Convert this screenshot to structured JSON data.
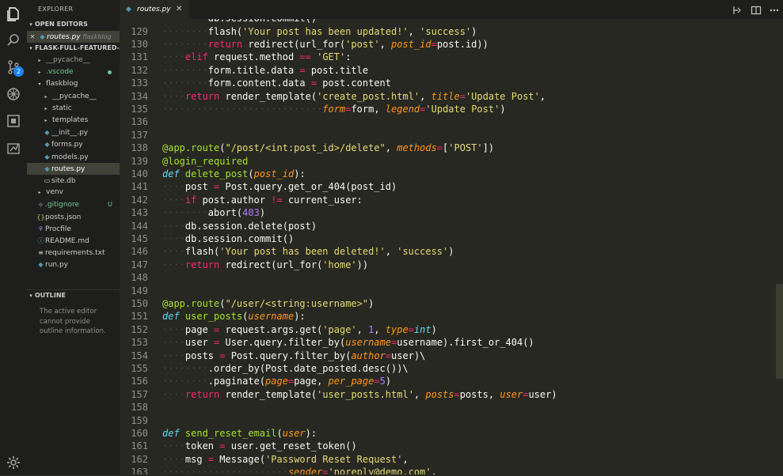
{
  "sidebar": {
    "title": "EXPLORER",
    "open_editors_header": "OPEN EDITORS",
    "open_editor": {
      "close": "✕",
      "name": "routes.py",
      "folder": "flaskblog"
    },
    "project_header": "FLASK-FULL-FEATURED-...",
    "tree": [
      {
        "name": "__pycache__",
        "depth": 0,
        "type": "folder",
        "state": "collapsed",
        "color": "#9d9d9d"
      },
      {
        "name": ".vscode",
        "depth": 0,
        "type": "folder",
        "state": "collapsed",
        "color": "#73c991",
        "dot": true
      },
      {
        "name": "flaskblog",
        "depth": 0,
        "type": "folder",
        "state": "expanded",
        "color": "#cccccc"
      },
      {
        "name": "__pycache__",
        "depth": 1,
        "type": "folder",
        "state": "collapsed",
        "color": "#cccccc"
      },
      {
        "name": "static",
        "depth": 1,
        "type": "folder",
        "state": "collapsed",
        "color": "#cccccc"
      },
      {
        "name": "templates",
        "depth": 1,
        "type": "folder",
        "state": "collapsed",
        "color": "#cccccc"
      },
      {
        "name": "__init__.py",
        "depth": 1,
        "type": "py",
        "color": "#cccccc"
      },
      {
        "name": "forms.py",
        "depth": 1,
        "type": "py",
        "color": "#cccccc"
      },
      {
        "name": "models.py",
        "depth": 1,
        "type": "py",
        "color": "#cccccc"
      },
      {
        "name": "routes.py",
        "depth": 1,
        "type": "py",
        "color": "#ffffff",
        "selected": true
      },
      {
        "name": "site.db",
        "depth": 1,
        "type": "db",
        "color": "#cccccc"
      },
      {
        "name": "venv",
        "depth": 0,
        "type": "folder",
        "state": "collapsed",
        "color": "#cccccc"
      },
      {
        "name": ".gitignore",
        "depth": 0,
        "type": "git",
        "color": "#73c991",
        "status": "U"
      },
      {
        "name": "posts.json",
        "depth": 0,
        "type": "json",
        "color": "#cccccc"
      },
      {
        "name": "Procfile",
        "depth": 0,
        "type": "procfile",
        "color": "#cccccc"
      },
      {
        "name": "README.md",
        "depth": 0,
        "type": "md",
        "color": "#cccccc"
      },
      {
        "name": "requirements.txt",
        "depth": 0,
        "type": "txt",
        "color": "#cccccc"
      },
      {
        "name": "run.py",
        "depth": 0,
        "type": "py",
        "color": "#cccccc"
      }
    ],
    "outline_header": "OUTLINE",
    "outline_message": "The active editor cannot provide outline information."
  },
  "activity_bar": {
    "items": [
      "explorer-icon",
      "search-icon",
      "source-control-icon",
      "debug-icon",
      "extensions-icon",
      "remote-explorer-icon"
    ],
    "source_control_badge": "2",
    "bottom": "gear-icon"
  },
  "tabs": [
    {
      "label": "routes.py",
      "close": "✕"
    }
  ],
  "tab_actions": [
    "open-changes-icon",
    "split-editor-icon",
    "more-actions-icon"
  ],
  "editor": {
    "lines": [
      {
        "n": "129",
        "ws": "········",
        "tokens": [
          [
            "n",
            "flash("
          ],
          [
            "s",
            "'Your post has been updated!'"
          ],
          [
            "n",
            ", "
          ],
          [
            "s",
            "'success'"
          ],
          [
            "n",
            ")"
          ]
        ]
      },
      {
        "n": "130",
        "ws": "········",
        "tokens": [
          [
            "k",
            "return"
          ],
          [
            "n",
            " redirect(url_for("
          ],
          [
            "s",
            "'post'"
          ],
          [
            "n",
            ", "
          ],
          [
            "p",
            "post_id"
          ],
          [
            "k",
            "="
          ],
          [
            "n",
            "post.id))"
          ]
        ]
      },
      {
        "n": "131",
        "ws": "····",
        "tokens": [
          [
            "k",
            "elif"
          ],
          [
            "n",
            " request.method "
          ],
          [
            "k",
            "=="
          ],
          [
            "n",
            " "
          ],
          [
            "s",
            "'GET'"
          ],
          [
            "n",
            ":"
          ]
        ]
      },
      {
        "n": "132",
        "ws": "········",
        "tokens": [
          [
            "n",
            "form.title.data "
          ],
          [
            "k",
            "="
          ],
          [
            "n",
            " post.title"
          ]
        ]
      },
      {
        "n": "133",
        "ws": "········",
        "tokens": [
          [
            "n",
            "form.content.data "
          ],
          [
            "k",
            "="
          ],
          [
            "n",
            " post.content"
          ]
        ]
      },
      {
        "n": "134",
        "ws": "····",
        "tokens": [
          [
            "k",
            "return"
          ],
          [
            "n",
            " render_template("
          ],
          [
            "s",
            "'create_post.html'"
          ],
          [
            "n",
            ", "
          ],
          [
            "p",
            "title"
          ],
          [
            "k",
            "="
          ],
          [
            "s",
            "'Update Post'"
          ],
          [
            "n",
            ","
          ]
        ]
      },
      {
        "n": "135",
        "ws": "····························",
        "tokens": [
          [
            "p",
            "form"
          ],
          [
            "k",
            "="
          ],
          [
            "n",
            "form, "
          ],
          [
            "p",
            "legend"
          ],
          [
            "k",
            "="
          ],
          [
            "s",
            "'Update Post'"
          ],
          [
            "n",
            ")"
          ]
        ]
      },
      {
        "n": "136",
        "ws": "",
        "tokens": []
      },
      {
        "n": "137",
        "ws": "",
        "tokens": []
      },
      {
        "n": "138",
        "ws": "",
        "tokens": [
          [
            "d",
            "@app.route"
          ],
          [
            "n",
            "("
          ],
          [
            "s",
            "\"/post/<int:post_id>/delete\""
          ],
          [
            "n",
            ", "
          ],
          [
            "p",
            "methods"
          ],
          [
            "k",
            "="
          ],
          [
            "n",
            "["
          ],
          [
            "s",
            "'POST'"
          ],
          [
            "n",
            "])"
          ]
        ]
      },
      {
        "n": "139",
        "ws": "",
        "tokens": [
          [
            "d",
            "@login_required"
          ]
        ]
      },
      {
        "n": "140",
        "ws": "",
        "tokens": [
          [
            "t",
            "def"
          ],
          [
            "n",
            " "
          ],
          [
            "f",
            "delete_post"
          ],
          [
            "n",
            "("
          ],
          [
            "p",
            "post_id"
          ],
          [
            "n",
            "):"
          ]
        ]
      },
      {
        "n": "141",
        "ws": "····",
        "tokens": [
          [
            "n",
            "post "
          ],
          [
            "k",
            "="
          ],
          [
            "n",
            " Post.query.get_or_404(post_id)"
          ]
        ]
      },
      {
        "n": "142",
        "ws": "····",
        "tokens": [
          [
            "k",
            "if"
          ],
          [
            "n",
            " post.author "
          ],
          [
            "k",
            "!="
          ],
          [
            "n",
            " current_user:"
          ]
        ]
      },
      {
        "n": "143",
        "ws": "········",
        "tokens": [
          [
            "n",
            "abort("
          ],
          [
            "c",
            "403"
          ],
          [
            "n",
            ")"
          ]
        ]
      },
      {
        "n": "144",
        "ws": "····",
        "tokens": [
          [
            "n",
            "db.session.delete(post)"
          ]
        ]
      },
      {
        "n": "145",
        "ws": "····",
        "tokens": [
          [
            "n",
            "db.session.commit()"
          ]
        ]
      },
      {
        "n": "146",
        "ws": "····",
        "tokens": [
          [
            "n",
            "flash("
          ],
          [
            "s",
            "'Your post has been deleted!'"
          ],
          [
            "n",
            ", "
          ],
          [
            "s",
            "'success'"
          ],
          [
            "n",
            ")"
          ]
        ]
      },
      {
        "n": "147",
        "ws": "····",
        "tokens": [
          [
            "k",
            "return"
          ],
          [
            "n",
            " redirect(url_for("
          ],
          [
            "s",
            "'home'"
          ],
          [
            "n",
            "))"
          ]
        ]
      },
      {
        "n": "148",
        "ws": "",
        "tokens": []
      },
      {
        "n": "149",
        "ws": "",
        "tokens": []
      },
      {
        "n": "150",
        "ws": "",
        "tokens": [
          [
            "d",
            "@app.route"
          ],
          [
            "n",
            "("
          ],
          [
            "s",
            "\"/user/<string:username>\""
          ],
          [
            "n",
            ")"
          ]
        ]
      },
      {
        "n": "151",
        "ws": "",
        "tokens": [
          [
            "t",
            "def"
          ],
          [
            "n",
            " "
          ],
          [
            "f",
            "user_posts"
          ],
          [
            "n",
            "("
          ],
          [
            "p",
            "username"
          ],
          [
            "n",
            "):"
          ]
        ]
      },
      {
        "n": "152",
        "ws": "····",
        "tokens": [
          [
            "n",
            "page "
          ],
          [
            "k",
            "="
          ],
          [
            "n",
            " request.args.get("
          ],
          [
            "s",
            "'page'"
          ],
          [
            "n",
            ", "
          ],
          [
            "c",
            "1"
          ],
          [
            "n",
            ", "
          ],
          [
            "p",
            "type"
          ],
          [
            "k",
            "="
          ],
          [
            "t",
            "int"
          ],
          [
            "n",
            ")"
          ]
        ]
      },
      {
        "n": "153",
        "ws": "····",
        "tokens": [
          [
            "n",
            "user "
          ],
          [
            "k",
            "="
          ],
          [
            "n",
            " User.query.filter_by("
          ],
          [
            "p",
            "username"
          ],
          [
            "k",
            "="
          ],
          [
            "n",
            "username).first_or_404()"
          ]
        ]
      },
      {
        "n": "154",
        "ws": "····",
        "tokens": [
          [
            "n",
            "posts "
          ],
          [
            "k",
            "="
          ],
          [
            "n",
            " Post.query.filter_by("
          ],
          [
            "p",
            "author"
          ],
          [
            "k",
            "="
          ],
          [
            "n",
            "user)\\"
          ]
        ]
      },
      {
        "n": "155",
        "ws": "········",
        "tokens": [
          [
            "n",
            ".order_by(Post.date_posted.desc())\\"
          ]
        ]
      },
      {
        "n": "156",
        "ws": "········",
        "tokens": [
          [
            "n",
            ".paginate("
          ],
          [
            "p",
            "page"
          ],
          [
            "k",
            "="
          ],
          [
            "n",
            "page, "
          ],
          [
            "p",
            "per_page"
          ],
          [
            "k",
            "="
          ],
          [
            "c",
            "5"
          ],
          [
            "n",
            ")"
          ]
        ]
      },
      {
        "n": "157",
        "ws": "····",
        "tokens": [
          [
            "k",
            "return"
          ],
          [
            "n",
            " render_template("
          ],
          [
            "s",
            "'user_posts.html'"
          ],
          [
            "n",
            ", "
          ],
          [
            "p",
            "posts"
          ],
          [
            "k",
            "="
          ],
          [
            "n",
            "posts, "
          ],
          [
            "p",
            "user"
          ],
          [
            "k",
            "="
          ],
          [
            "n",
            "user)"
          ]
        ]
      },
      {
        "n": "158",
        "ws": "",
        "tokens": []
      },
      {
        "n": "159",
        "ws": "",
        "tokens": []
      },
      {
        "n": "160",
        "ws": "",
        "tokens": [
          [
            "t",
            "def"
          ],
          [
            "n",
            " "
          ],
          [
            "f",
            "send_reset_email"
          ],
          [
            "n",
            "("
          ],
          [
            "p",
            "user"
          ],
          [
            "n",
            "):"
          ]
        ]
      },
      {
        "n": "161",
        "ws": "····",
        "tokens": [
          [
            "n",
            "token "
          ],
          [
            "k",
            "="
          ],
          [
            "n",
            " user.get_reset_token()"
          ]
        ]
      },
      {
        "n": "162",
        "ws": "····",
        "tokens": [
          [
            "n",
            "msg "
          ],
          [
            "k",
            "="
          ],
          [
            "n",
            " Message("
          ],
          [
            "s",
            "'Password Reset Request'"
          ],
          [
            "n",
            ","
          ]
        ]
      },
      {
        "n": "163",
        "ws": "······················",
        "tokens": [
          [
            "p",
            "sender"
          ],
          [
            "k",
            "="
          ],
          [
            "s",
            "'noreply@demo.com'"
          ],
          [
            "n",
            ","
          ]
        ]
      }
    ],
    "top_partial": {
      "ws": "········",
      "tokens": [
        [
          "n",
          "db.session.commit()"
        ]
      ]
    }
  }
}
